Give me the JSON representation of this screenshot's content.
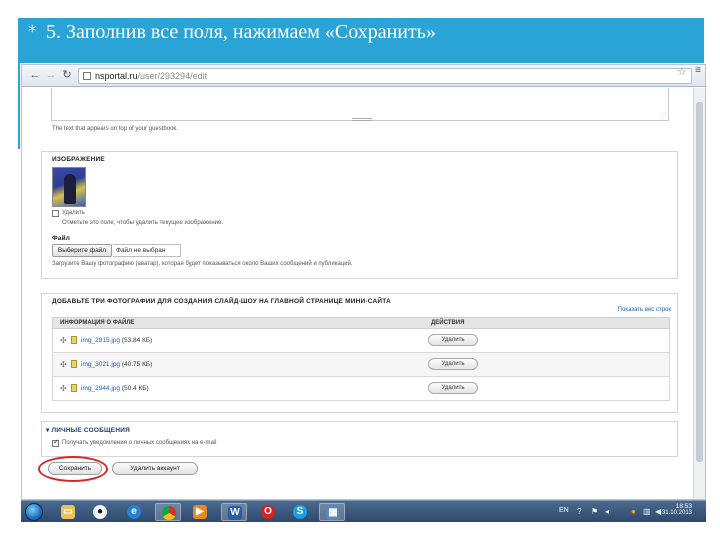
{
  "slide": {
    "bullet": "*",
    "title": "5. Заполнив все поля, нажимаем «Сохранить»"
  },
  "browser": {
    "url_host": "nsportal.ru",
    "url_path": "/user/293294/edit"
  },
  "guestbook": {
    "hint": "The text that appears on top of your guestbook."
  },
  "image_section": {
    "legend": "ИЗОБРАЖЕНИЕ",
    "delete_checkbox_label": "Удалить",
    "delete_hint": "Отметьте это поле, чтобы удалить текущее изображение.",
    "file_label": "Файл",
    "choose_file_button": "Выберите файл",
    "file_status": "Файл не выбран",
    "upload_hint": "Загрузите Вашу фотографию (аватар), которая будет показываться около Ваших сообщений и публикаций."
  },
  "slideshow": {
    "legend": "ДОБАВЬТЕ ТРИ ФОТОГРАФИИ ДЛЯ СОЗДАНИЯ СЛАЙД-ШОУ НА ГЛАВНОЙ СТРАНИЦЕ МИНИ-САЙТА",
    "show_weights_link": "Показать вес строк",
    "columns": [
      "ИНФОРМАЦИЯ О ФАЙЛЕ",
      "ДЕЙСТВИЯ"
    ],
    "rows": [
      {
        "file_name": "img_2815.jpg",
        "file_size": "(53.84 КБ)",
        "action": "Удалить"
      },
      {
        "file_name": "img_3021.jpg",
        "file_size": "(40.75 КБ)",
        "action": "Удалить"
      },
      {
        "file_name": "img_2944.jpg",
        "file_size": "(50.4 КБ)",
        "action": "Удалить"
      }
    ]
  },
  "private_messages": {
    "legend": "▾ ЛИЧНЫЕ СООБЩЕНИЯ",
    "notify_label": "Получать уведомления о личных сообщениях на e-mail",
    "notify_checked": true
  },
  "actions": {
    "save": "Сохранить",
    "delete_account": "Удалить аккаунт"
  },
  "taskbar": {
    "language": "EN",
    "time": "18:53",
    "date": "31.10.2013"
  },
  "colors": {
    "slide_header": "#2aa3d6",
    "link": "#1e5fb3",
    "highlight": "#d42a2a"
  }
}
